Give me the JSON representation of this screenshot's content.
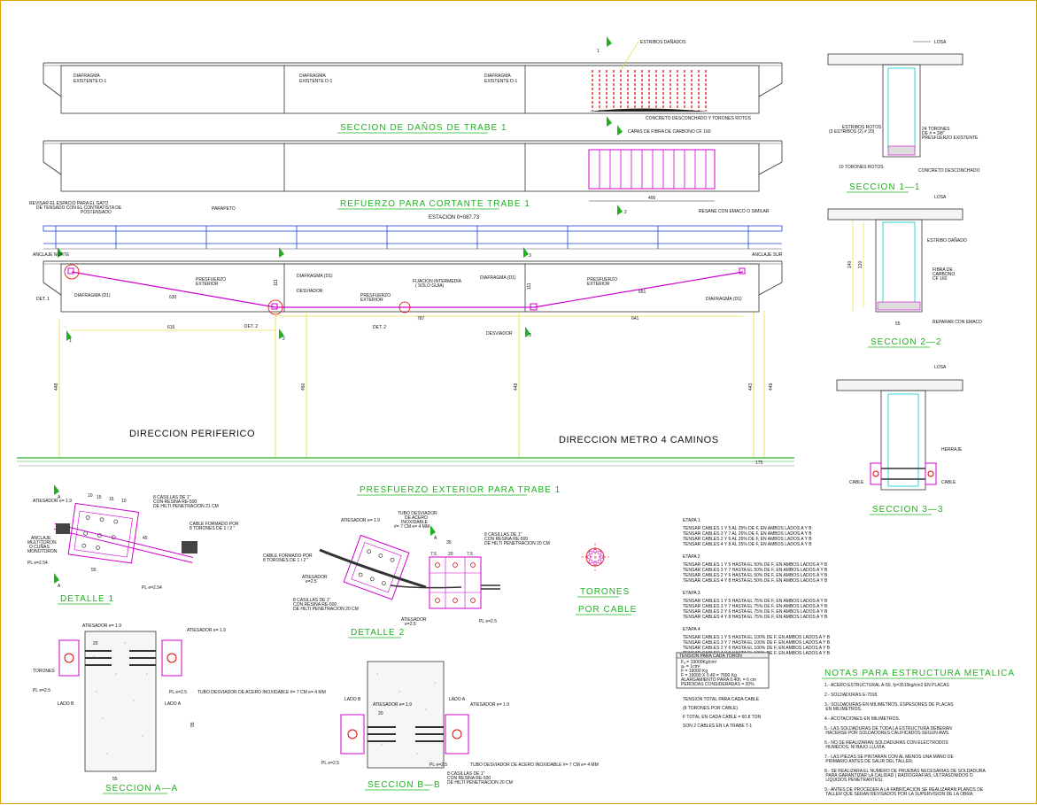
{
  "titles": {
    "seccion_danos": "SECCION  DE  DAÑOS  DE  TRABE  1",
    "refuerzo_cortante": "REFUERZO  PARA  CORTANTE  TRABE  1",
    "estacion": "ESTACION  0+087.73",
    "presfuerzo_exterior": "PRESFUERZO  EXTERIOR  PARA  TRABE  1",
    "seccion_1_1": "SECCION  1—1",
    "seccion_2_2": "SECCION  2—2",
    "seccion_3_3": "SECCION  3—3",
    "detalle_1": "DETALLE  1",
    "detalle_2": "DETALLE  2",
    "seccion_a_a": "SECCION  A—A",
    "seccion_b_b": "SECCION  B—B",
    "torones": "TORONES",
    "por_cable": "POR  CABLE",
    "notas_titulo": "NOTAS  PARA  ESTRUCTURA  METALICA"
  },
  "directions": {
    "periferico": "DIRECCION  PERIFERICO",
    "metro": "DIRECCION  METRO  4  CAMINOS"
  },
  "elevation_labels": {
    "diafragma": "DIAFRAGMA\nEXISTENTE  D-1",
    "estribos_danados": "ESTRIBOS  DAÑADOS",
    "concreto_desc": "CONCRETO  DESCONCHADO  Y  TORONES  ROTOS",
    "capas_fibra": "CAPAS  DE  FIBRA  DE  CARBONO  CF  160",
    "resane": "RESANE  CON  EMACO  O  SIMILAR",
    "dim_400": "400",
    "revisar": "REVISAR  EL  ESPACIO  PARA  EL  GATO\nDE  TENSADO  CON  EL  CONTRATISTA  DE\nPOSTENSADO",
    "parapeto": "PARAPETO",
    "anclaje_norte": "ANCLAJE  NORTE",
    "anclaje_sur": "ANCLAJE  SUR",
    "diafragma_d1": "DIAFRAGMA  (D1)",
    "presfuerzo_ext": "PRESFUERZO\nEXTERIOR",
    "fijacion": "FIJACION  INTERMEDIA\n(  SOLO  GUIA)",
    "desviador": "DESVIADOR",
    "det1": "DET. 1",
    "det2": "DET. 2",
    "d630": "630",
    "d616": "616",
    "d787": "787",
    "d651": "651",
    "d641": "641",
    "d111": "111",
    "d448": "448",
    "d450": "450",
    "d443": "443",
    "d449": "449",
    "d175": "175",
    "mark_1": "1",
    "mark_2": "2",
    "mark_3": "3",
    "mark_A": "A"
  },
  "section_labels": {
    "losa": "LOSA",
    "estribos_rotos": "ESTRIBOS  ROTOS\n(3  ESTRIBOS  (2) # 20)",
    "torones_24": "24  TORONES\nDE  # = 3/8\"\nPRESFUERZO  EXISTENTE",
    "torones_rotos": "10  TORONES  ROTOS",
    "concreto_desconchado": "CONCRETO  DESCONCHADO",
    "estribo_danado": "ESTRIBO  DAÑADO",
    "fibra_carbono": "FIBRA  DE\nCARBONO\nCF  160",
    "reparar": "REPARAR  CON  EMACO",
    "d140": "140",
    "d120": "120",
    "d55": "55",
    "herraje": "HERRAJE",
    "cable": "CABLE"
  },
  "detail_labels": {
    "atiesador_19": "ATIESADOR  e=  1.9",
    "cuatro_varillas": "8  CASILLAS  DE  1\"\nCON  RESINA  RE-500\nDE  HILTI  PENETRACION  21  CM",
    "anclaje_multitoron": "ANCLAJE\nMULTITORON\nO  CUÑAS\nMONOTORON",
    "cable_formado": "CABLE  FORMADO  POR\n8  TORONES  DE  1 / 2 \"",
    "pl_254": "PL  e=2.54",
    "tubo_desviador": "TUBO  DESVIADOR\nDE  ACERO\nINOXIDABLE\n#=  7  CM  e=  4  MM",
    "atiesador_25": "ATIESADOR\ne=2.5",
    "pl_25": "PL  e=2.5",
    "lado_a": "LADO  A",
    "lado_b": "LADO  B",
    "torones": "TORONES",
    "d20": "20",
    "d55": "55",
    "d95": "95",
    "d15": "15",
    "d10": "10",
    "d45": "45",
    "d75": "7.5",
    "d35": "35"
  },
  "etapas": [
    {
      "title": "ETAPA  1",
      "lines": [
        "TENSAR  CABLES  1  Y  5  AL  25%  DE  F,  EN  AMBOS  LADOS  A  Y  B",
        "TENSAR  CABLES  3  Y  7  AL  25%  DE  F,  EN  AMBOS  LADOS  A  Y  B",
        "TENSAR  CABLES  2  Y  6  AL  25%  DE  F,  EN  AMBOS  LADOS  A  Y  B",
        "TENSAR  CABLES  4  Y  8  AL  25%  DE  F,  EN  AMBOS  LADOS  A  Y  B"
      ]
    },
    {
      "title": "ETAPA  2",
      "lines": [
        "TENSAR  CABLES  1  Y  5  HASTA  EL  50%  DE  F,  EN  AMBOS  LADOS  A  Y  B",
        "TENSAR  CABLES  3  Y  7  HASTA  EL  50%  DE  F,  EN  AMBOS  LADOS  A  Y  B",
        "TENSAR  CABLES  2  Y  6  HASTA  EL  50%  DE  F,  EN  AMBOS  LADOS  A  Y  B",
        "TENSAR  CABLES  4  Y  8  HASTA  EL  50%  DE  F,  EN  AMBOS  LADOS  A  Y  B"
      ]
    },
    {
      "title": "ETAPA  3",
      "lines": [
        "TENSAR  CABLES  1  Y  5  HASTA  EL  75%  DE  F,  EN  AMBOS  LADOS  A  Y  B",
        "TENSAR  CABLES  3  Y  7  HASTA  EL  75%  DE  F,  EN  AMBOS  LADOS  A  Y  B",
        "TENSAR  CABLES  2  Y  6  HASTA  EL  75%  DE  F,  EN  AMBOS  LADOS  A  Y  B",
        "TENSAR  CABLES  4  Y  8  HASTA  EL  75%  DE  F,  EN  AMBOS  LADOS  A  Y  B"
      ]
    },
    {
      "title": "ETAPA  4",
      "lines": [
        "TENSAR  CABLES  1  Y  5  HASTA  EL  100%  DE  F,  EN  AMBOS  LADOS  A  Y  B",
        "TENSAR  CABLES  3  Y  7  HASTA  EL  100%  DE  F,  EN  AMBOS  LADOS  A  Y  B",
        "TENSAR  CABLES  2  Y  6  HASTA  EL  100%  DE  F,  EN  AMBOS  LADOS  A  Y  B",
        "TENSAR  CABLES  4  Y  8  HASTA  EL  100%  DE  F,  EN  AMBOS  LADOS  A  Y  B"
      ]
    }
  ],
  "tension_box": {
    "title": "TENSION  PARA  CADA  TORON",
    "lines": [
      "Fₐ  =  19000Kg/cm²",
      "aₛ  =  1cm²",
      "F  =  19000  Kg",
      "F  =  19000  X  0.40  =  7600  Kg",
      "ALARGAMIENTO  PARA  0.40fₛ  =  6  cm",
      "PERDIDAS  CONSIDERADAS  =  20%"
    ]
  },
  "tension_total": [
    "TENSION  TOTAL  PARA  CADA  CABLE",
    "(8  TORONES  POR  CABLE)",
    "F  TOTAL  EN  CADA  CABLE  =  60.8  TON",
    "SON  2  CABLES  EN  LA  TRABE  T-1"
  ],
  "notas": [
    "1.-   ACERO  ESTRUCTURAL  A-50,  fy=3515kg/cm2  EN  PLACAS",
    "2.-   SOLDADURAS  E-7018.",
    "3.-   SOLDADURAS  EN  MILIMETROS,  ESPESORES  DE  PLACAS\n         EN  MILIMETROS.",
    "4.-   ACOTACIONES  EN  MILIMETROS.",
    "5.-   LAS  SOLDADURAS  DE  TODA  LA  ESTRUCTURA  DEBERAN\n         HACERSE  POR  SOLDADORES  CALIFICADOS  SEGUN  AWS.",
    "6.-   NO  SE  REALIZARAN  SOLDADURAS  CON  ELECTRODOS\n         HUMEDOS,  NI  BAJO  LLUVIA.",
    "7.-   LAS  PIEZAS  SE  PINTARAN  CON  AL  MENOS  UNA  MANO  DE\n         PRIMARIO  ANTES  DE  SALIR  DEL  TALLER.",
    "8.-   SE  REALIZARA  EL  NUMERO  DE  PRUEBAS  NECESARIAS  DE  SOLDADURA\n         PARA  GARANTIZAR  LA  CALIDAD  ( RADIOGRAFIAS,  ULTRASONIDOS  O\n         LIQUIDOS  PENETRANTES).",
    "9.-   ANTES  DE  PROCEDER  A  LA  FABRICACION  SE  REALIZARAN  PLANOS  DE\n         TALLER  QUE  SERAN  REVISADOS  POR  LA  SUPERVISION  DE  LA  OBRA."
  ],
  "colors": {
    "green": "#20b020",
    "magenta": "#d000d0",
    "red": "#e00000",
    "cyan": "#00c8c8",
    "yellow": "#e0d000",
    "blue": "#2040d0"
  }
}
